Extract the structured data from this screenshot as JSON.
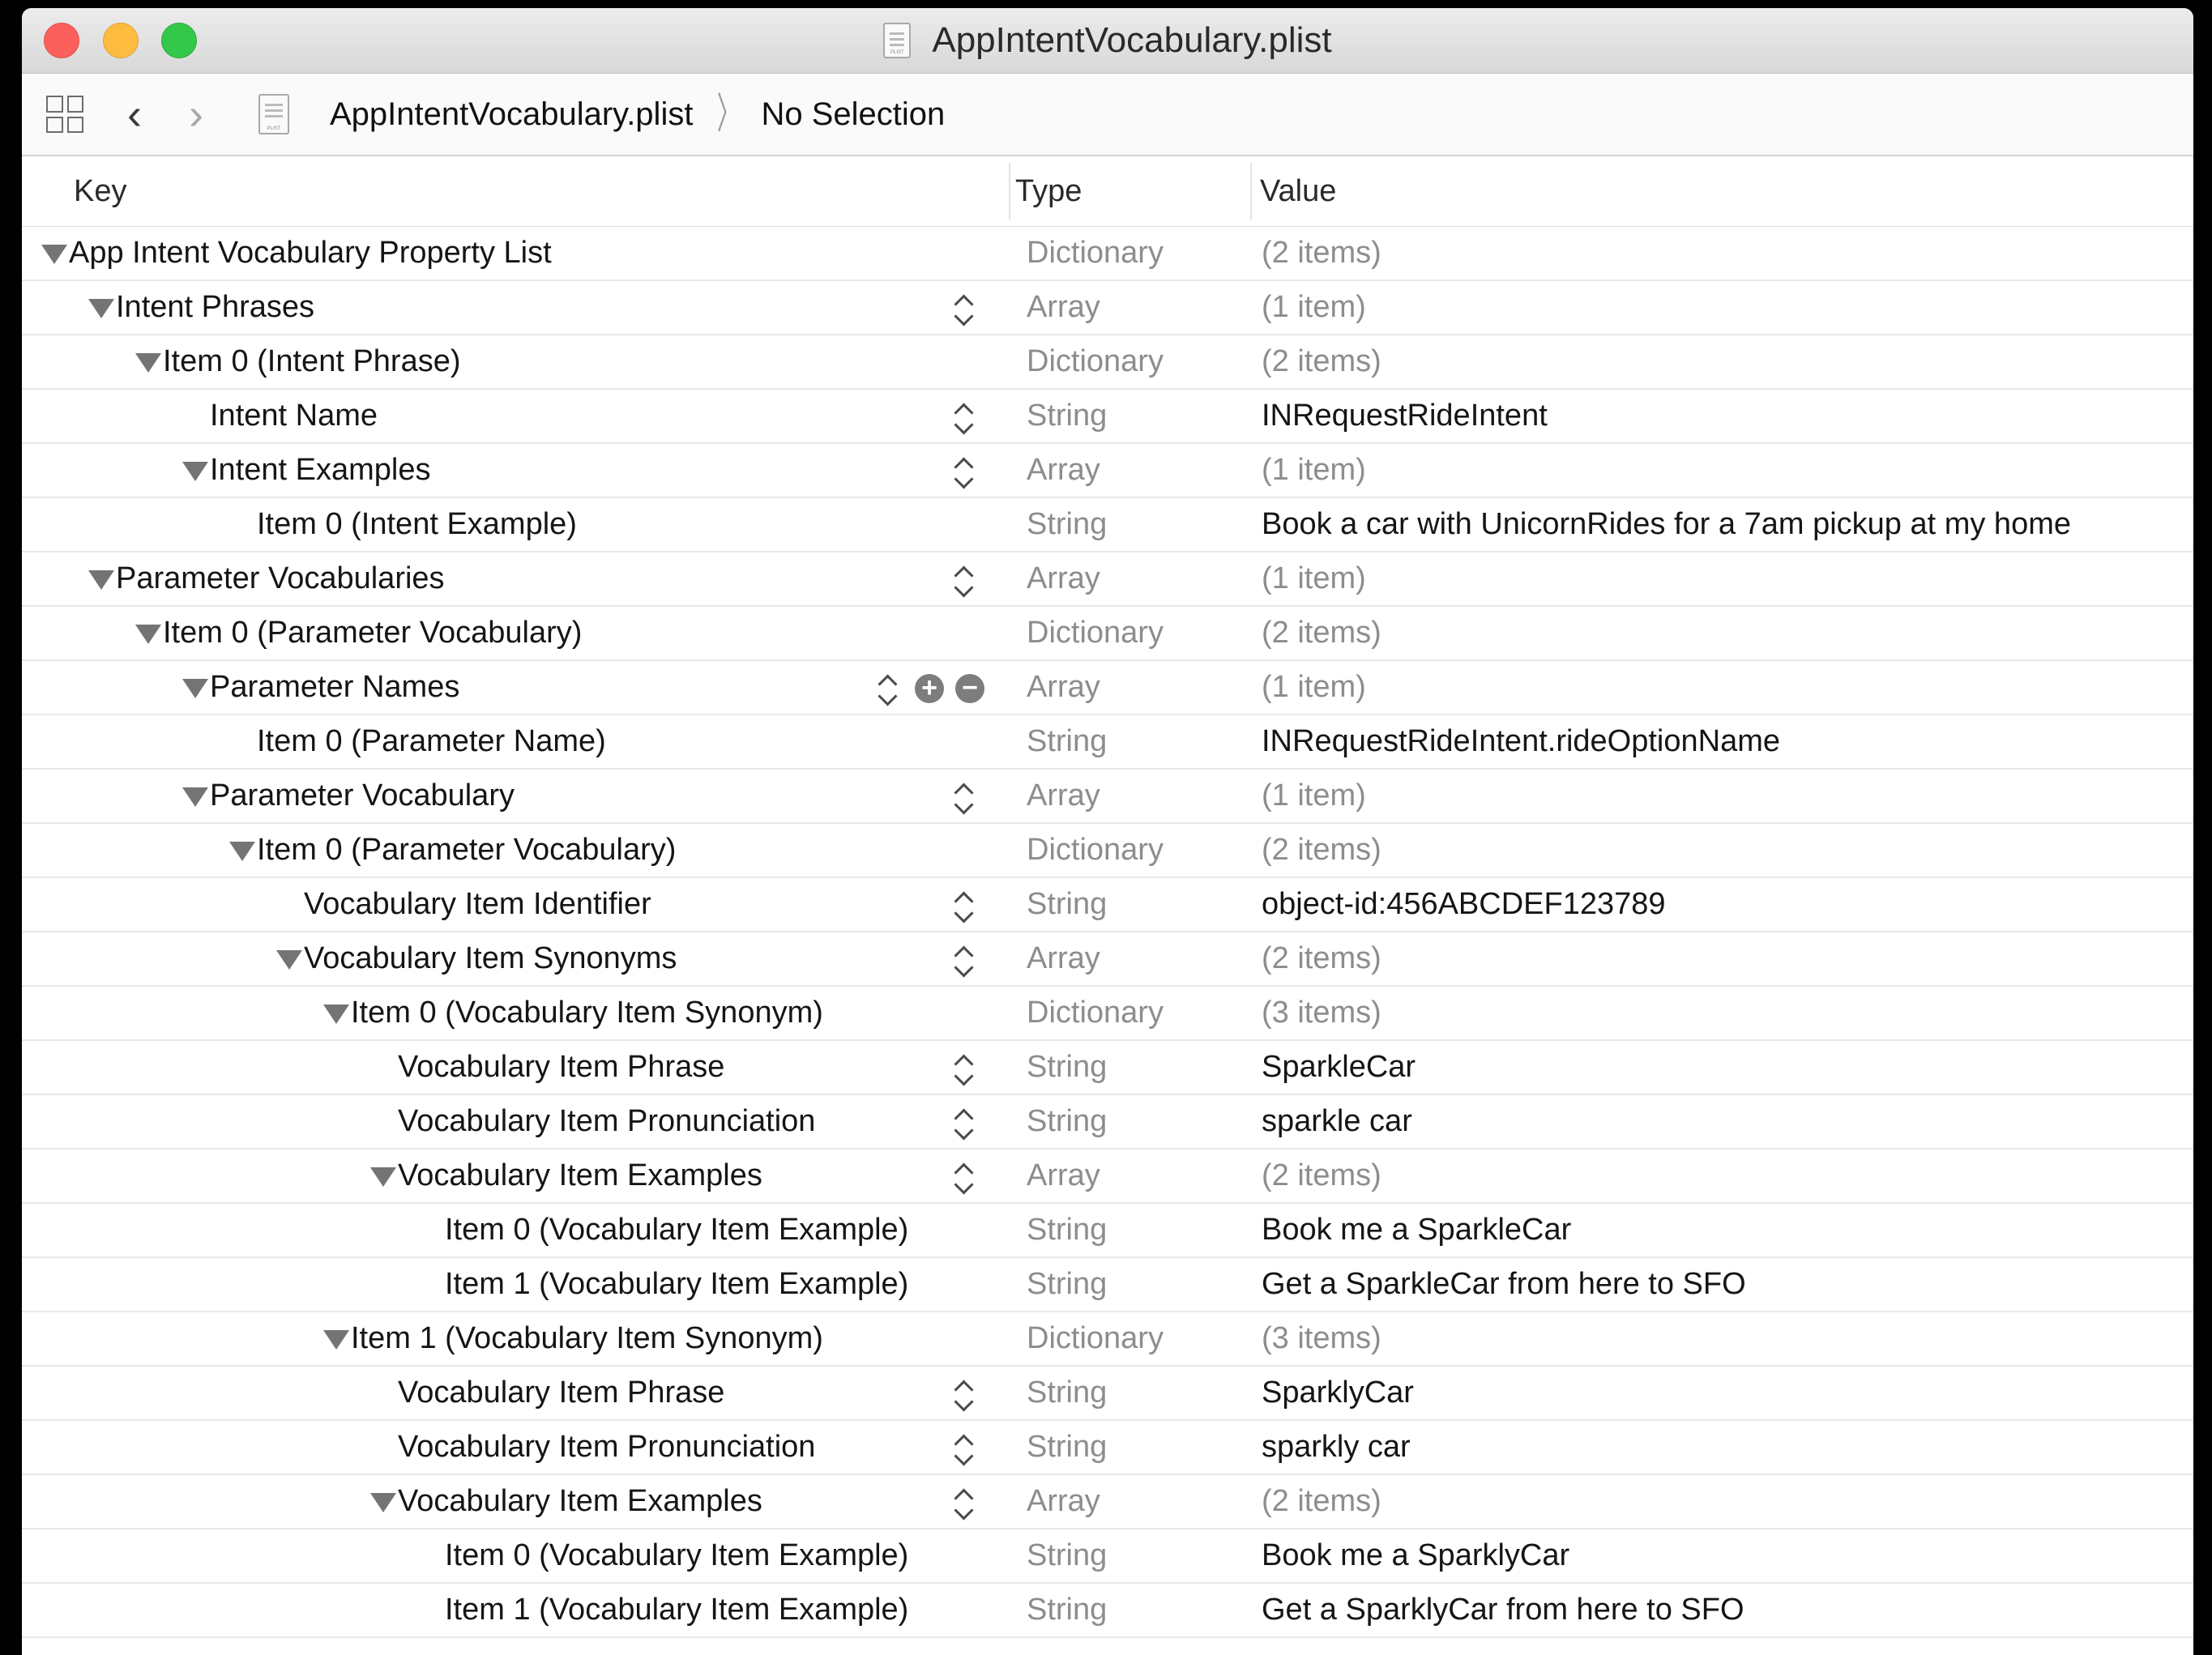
{
  "window": {
    "title": "AppIntentVocabulary.plist"
  },
  "pathbar": {
    "file": "AppIntentVocabulary.plist",
    "selection": "No Selection"
  },
  "columns": {
    "key": "Key",
    "type": "Type",
    "value": "Value"
  },
  "rows": [
    {
      "key": "App Intent Vocabulary Property List",
      "type": "Dictionary",
      "value": "(2 items)",
      "depth": 0,
      "expandable": true,
      "stepper": false,
      "literal": false
    },
    {
      "key": "Intent Phrases",
      "type": "Array",
      "value": "(1 item)",
      "depth": 1,
      "expandable": true,
      "stepper": true,
      "literal": false
    },
    {
      "key": "Item 0 (Intent Phrase)",
      "type": "Dictionary",
      "value": "(2 items)",
      "depth": 2,
      "expandable": true,
      "stepper": false,
      "literal": false
    },
    {
      "key": "Intent Name",
      "type": "String",
      "value": "INRequestRideIntent",
      "depth": 3,
      "expandable": false,
      "stepper": true,
      "literal": true
    },
    {
      "key": "Intent Examples",
      "type": "Array",
      "value": "(1 item)",
      "depth": 3,
      "expandable": true,
      "stepper": true,
      "literal": false
    },
    {
      "key": "Item 0 (Intent Example)",
      "type": "String",
      "value": "Book a car with UnicornRides for a 7am pickup at my home",
      "depth": 4,
      "expandable": false,
      "stepper": false,
      "literal": true
    },
    {
      "key": "Parameter Vocabularies",
      "type": "Array",
      "value": "(1 item)",
      "depth": 1,
      "expandable": true,
      "stepper": true,
      "literal": false
    },
    {
      "key": "Item 0 (Parameter Vocabulary)",
      "type": "Dictionary",
      "value": "(2 items)",
      "depth": 2,
      "expandable": true,
      "stepper": false,
      "literal": false
    },
    {
      "key": "Parameter Names",
      "type": "Array",
      "value": "(1 item)",
      "depth": 3,
      "expandable": true,
      "stepper": true,
      "literal": false,
      "addremove": true
    },
    {
      "key": "Item 0 (Parameter Name)",
      "type": "String",
      "value": "INRequestRideIntent.rideOptionName",
      "depth": 4,
      "expandable": false,
      "stepper": false,
      "literal": true
    },
    {
      "key": "Parameter Vocabulary",
      "type": "Array",
      "value": "(1 item)",
      "depth": 3,
      "expandable": true,
      "stepper": true,
      "literal": false
    },
    {
      "key": "Item 0 (Parameter Vocabulary)",
      "type": "Dictionary",
      "value": "(2 items)",
      "depth": 4,
      "expandable": true,
      "stepper": false,
      "literal": false
    },
    {
      "key": "Vocabulary Item Identifier",
      "type": "String",
      "value": "object-id:456ABCDEF123789",
      "depth": 5,
      "expandable": false,
      "stepper": true,
      "literal": true
    },
    {
      "key": "Vocabulary Item Synonyms",
      "type": "Array",
      "value": "(2 items)",
      "depth": 5,
      "expandable": true,
      "stepper": true,
      "literal": false
    },
    {
      "key": "Item 0 (Vocabulary Item Synonym)",
      "type": "Dictionary",
      "value": "(3 items)",
      "depth": 6,
      "expandable": true,
      "stepper": false,
      "literal": false
    },
    {
      "key": "Vocabulary Item Phrase",
      "type": "String",
      "value": "SparkleCar",
      "depth": 7,
      "expandable": false,
      "stepper": true,
      "literal": true
    },
    {
      "key": "Vocabulary Item Pronunciation",
      "type": "String",
      "value": "sparkle car",
      "depth": 7,
      "expandable": false,
      "stepper": true,
      "literal": true
    },
    {
      "key": "Vocabulary Item Examples",
      "type": "Array",
      "value": "(2 items)",
      "depth": 7,
      "expandable": true,
      "stepper": true,
      "literal": false
    },
    {
      "key": "Item 0 (Vocabulary Item Example)",
      "type": "String",
      "value": "Book me a SparkleCar",
      "depth": 8,
      "expandable": false,
      "stepper": false,
      "literal": true
    },
    {
      "key": "Item 1 (Vocabulary Item Example)",
      "type": "String",
      "value": "Get a SparkleCar from here to SFO",
      "depth": 8,
      "expandable": false,
      "stepper": false,
      "literal": true
    },
    {
      "key": "Item 1 (Vocabulary Item Synonym)",
      "type": "Dictionary",
      "value": "(3 items)",
      "depth": 6,
      "expandable": true,
      "stepper": false,
      "literal": false
    },
    {
      "key": "Vocabulary Item Phrase",
      "type": "String",
      "value": "SparklyCar",
      "depth": 7,
      "expandable": false,
      "stepper": true,
      "literal": true
    },
    {
      "key": "Vocabulary Item Pronunciation",
      "type": "String",
      "value": "sparkly car",
      "depth": 7,
      "expandable": false,
      "stepper": true,
      "literal": true
    },
    {
      "key": "Vocabulary Item Examples",
      "type": "Array",
      "value": "(2 items)",
      "depth": 7,
      "expandable": true,
      "stepper": true,
      "literal": false
    },
    {
      "key": "Item 0 (Vocabulary Item Example)",
      "type": "String",
      "value": "Book me a SparklyCar",
      "depth": 8,
      "expandable": false,
      "stepper": false,
      "literal": true
    },
    {
      "key": "Item 1 (Vocabulary Item Example)",
      "type": "String",
      "value": "Get a SparklyCar from here to SFO",
      "depth": 8,
      "expandable": false,
      "stepper": false,
      "literal": true
    }
  ],
  "icons": {
    "close": "close-icon",
    "minimize": "minimize-icon",
    "zoom": "zoom-icon",
    "grid": "grid-icon",
    "back": "chevron-left-icon",
    "forward": "chevron-right-icon",
    "plist_file": "plist-file-icon",
    "stepper": "stepper-icon",
    "add": "plus-circle-icon",
    "remove": "minus-circle-icon",
    "disclosure": "disclosure-triangle-icon"
  },
  "colors": {
    "close": "#fc605c",
    "minimize": "#fdbc40",
    "zoom": "#34c84a"
  }
}
